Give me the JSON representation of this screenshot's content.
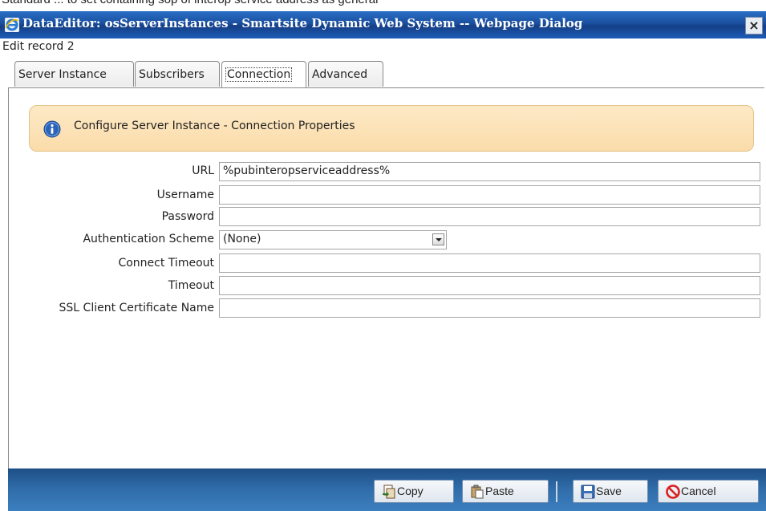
{
  "background_caption": "Standard ... to set containing sop of interop service address as general",
  "window": {
    "title": "DataEditor: osServerInstances - Smartsite Dynamic Web System -- Webpage Dialog",
    "close_glyph": "×",
    "icon": "ie-icon"
  },
  "record_label": "Edit record 2",
  "tabs": [
    {
      "label": "Server Instance",
      "active": false
    },
    {
      "label": "Subscribers",
      "active": false
    },
    {
      "label": "Connection",
      "active": true
    },
    {
      "label": "Advanced",
      "active": false
    }
  ],
  "info_box": {
    "icon": "info-icon",
    "message": "Configure Server Instance - Connection Properties"
  },
  "form": {
    "url": {
      "label": "URL",
      "value": "%pubinteropserviceaddress%"
    },
    "username": {
      "label": "Username",
      "value": ""
    },
    "password": {
      "label": "Password",
      "value": ""
    },
    "auth_scheme": {
      "label": "Authentication Scheme",
      "value": "(None)"
    },
    "connect_timeout": {
      "label": "Connect Timeout",
      "value": ""
    },
    "timeout": {
      "label": "Timeout",
      "value": ""
    },
    "ssl_cert": {
      "label": "SSL Client Certificate Name",
      "value": ""
    }
  },
  "footer": {
    "copy": "Copy",
    "paste": "Paste",
    "save": "Save",
    "cancel": "Cancel"
  },
  "colors": {
    "titlebar": "#1a4f9e",
    "info_background": "#fbdcaa",
    "footer": "#2f6ba8",
    "cancel_icon": "#d92020"
  }
}
